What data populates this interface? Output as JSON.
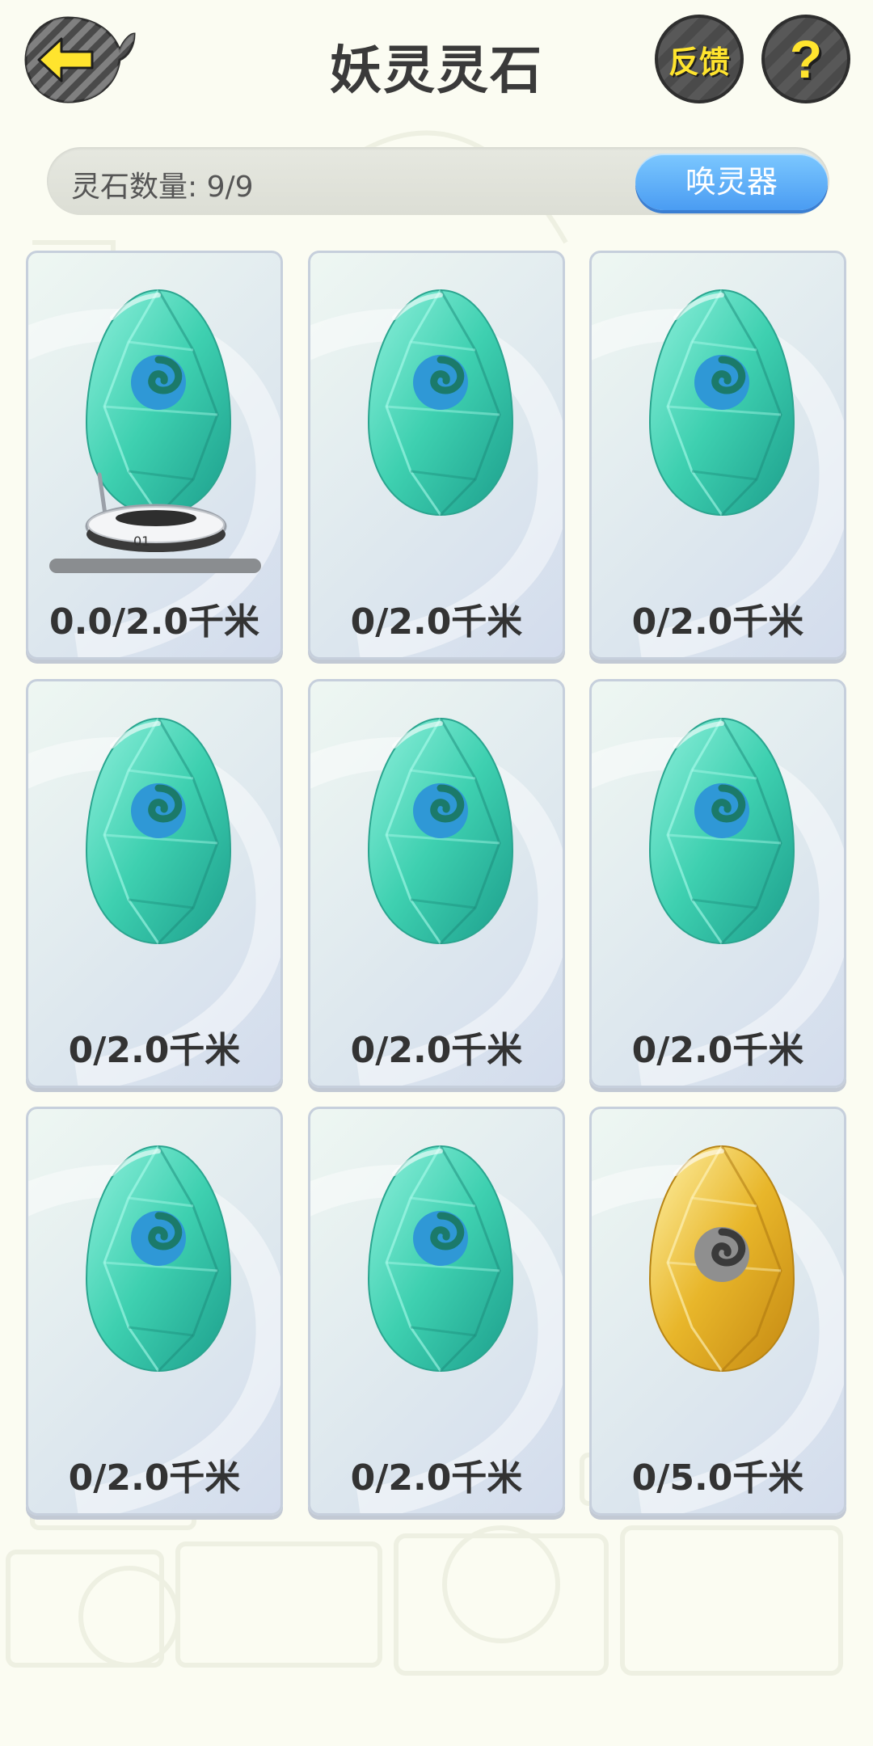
{
  "header": {
    "title": "妖灵灵石",
    "feedback_label": "反馈",
    "help_label": "?"
  },
  "counter": {
    "label": "灵石数量: 9/9",
    "summon_label": "唤灵器"
  },
  "colors": {
    "accent_yellow": "#ffe42e",
    "summon_blue": "#4a9cf2",
    "stone_green": "#3ed0b0",
    "stone_gold": "#e8b62a"
  },
  "stones": [
    {
      "distance": "0.0/2.0千米",
      "type": "green",
      "incubating": true,
      "progress": 0.0,
      "incubator_label": "01"
    },
    {
      "distance": "0/2.0千米",
      "type": "green",
      "incubating": false
    },
    {
      "distance": "0/2.0千米",
      "type": "green",
      "incubating": false
    },
    {
      "distance": "0/2.0千米",
      "type": "green",
      "incubating": false
    },
    {
      "distance": "0/2.0千米",
      "type": "green",
      "incubating": false
    },
    {
      "distance": "0/2.0千米",
      "type": "green",
      "incubating": false
    },
    {
      "distance": "0/2.0千米",
      "type": "green",
      "incubating": false
    },
    {
      "distance": "0/2.0千米",
      "type": "green",
      "incubating": false
    },
    {
      "distance": "0/5.0千米",
      "type": "gold",
      "incubating": false
    }
  ],
  "icons": {
    "back": "back-arrow-icon",
    "help": "question-icon"
  }
}
